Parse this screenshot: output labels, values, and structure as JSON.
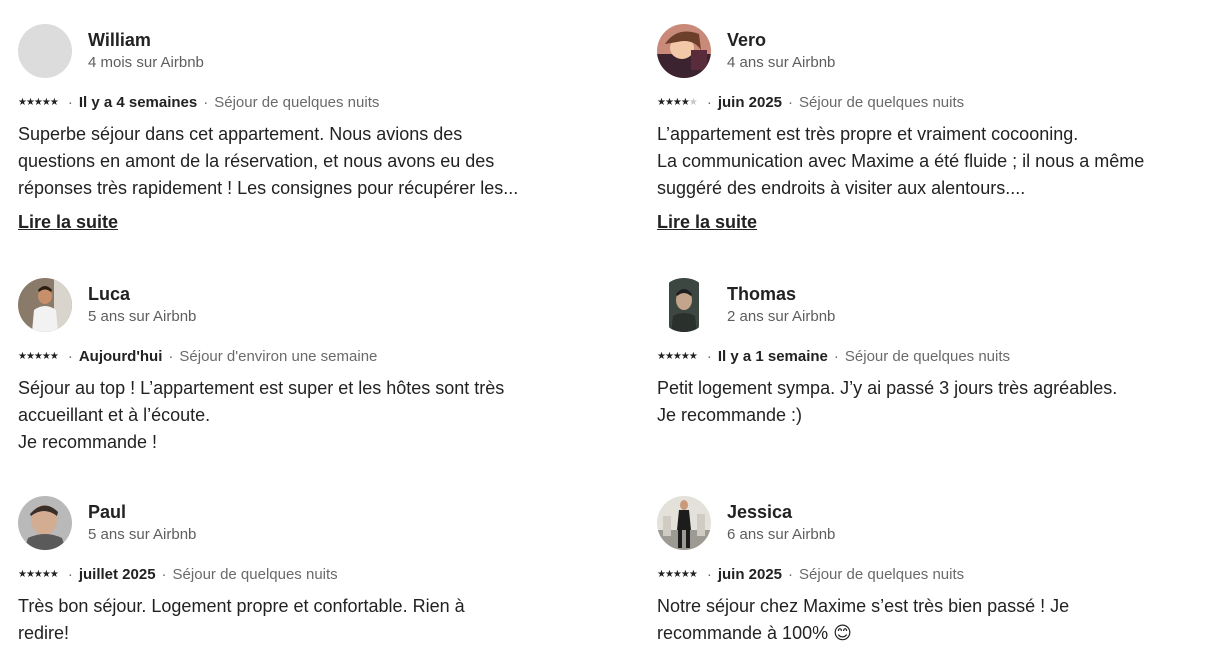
{
  "reviews": [
    {
      "name": "William",
      "tenure": "4 mois sur Airbnb",
      "stars": "★★★★★",
      "stars_off": "",
      "date": "Il y a 4 semaines",
      "stay": "Séjour de quelques nuits",
      "text": "Superbe séjour dans cet appartement. Nous avions des\nquestions en amont de la réservation, et nous avons eu des\nréponses très rapidement ! Les consignes pour récupérer les...",
      "more": "Lire la suite"
    },
    {
      "name": "Vero",
      "tenure": "4 ans sur Airbnb",
      "stars": "★★★★",
      "stars_off": "★",
      "date": "juin 2025",
      "stay": "Séjour de quelques nuits",
      "text": "L’appartement est très propre et vraiment cocooning.\nLa communication avec Maxime  a été fluide ; il nous a même\nsuggéré des endroits à visiter aux alentours....",
      "more": "Lire la suite"
    },
    {
      "name": "Luca",
      "tenure": "5 ans sur Airbnb",
      "stars": "★★★★★",
      "stars_off": "",
      "date": "Aujourd'hui",
      "stay": "Séjour d'environ une semaine",
      "text": "Séjour au top ! L’appartement est super et les hôtes sont très\naccueillant et à l’écoute.\nJe recommande !"
    },
    {
      "name": "Thomas",
      "tenure": "2 ans sur Airbnb",
      "stars": "★★★★★",
      "stars_off": "",
      "date": "Il y a 1 semaine",
      "stay": "Séjour de quelques nuits",
      "text": "Petit logement sympa. J’y ai passé 3 jours très agréables.\nJe recommande :)"
    },
    {
      "name": "Paul",
      "tenure": "5 ans sur Airbnb",
      "stars": "★★★★★",
      "stars_off": "",
      "date": "juillet 2025",
      "stay": "Séjour de quelques nuits",
      "text": "Très bon séjour. Logement propre et confortable. Rien à\nredire!"
    },
    {
      "name": "Jessica",
      "tenure": "6 ans sur Airbnb",
      "stars": "★★★★★",
      "stars_off": "",
      "date": "juin 2025",
      "stay": "Séjour de quelques nuits",
      "text": "Notre séjour chez Maxime s’est très bien passé ! Je\nrecommande à 100% 😊"
    }
  ],
  "separator": "·"
}
